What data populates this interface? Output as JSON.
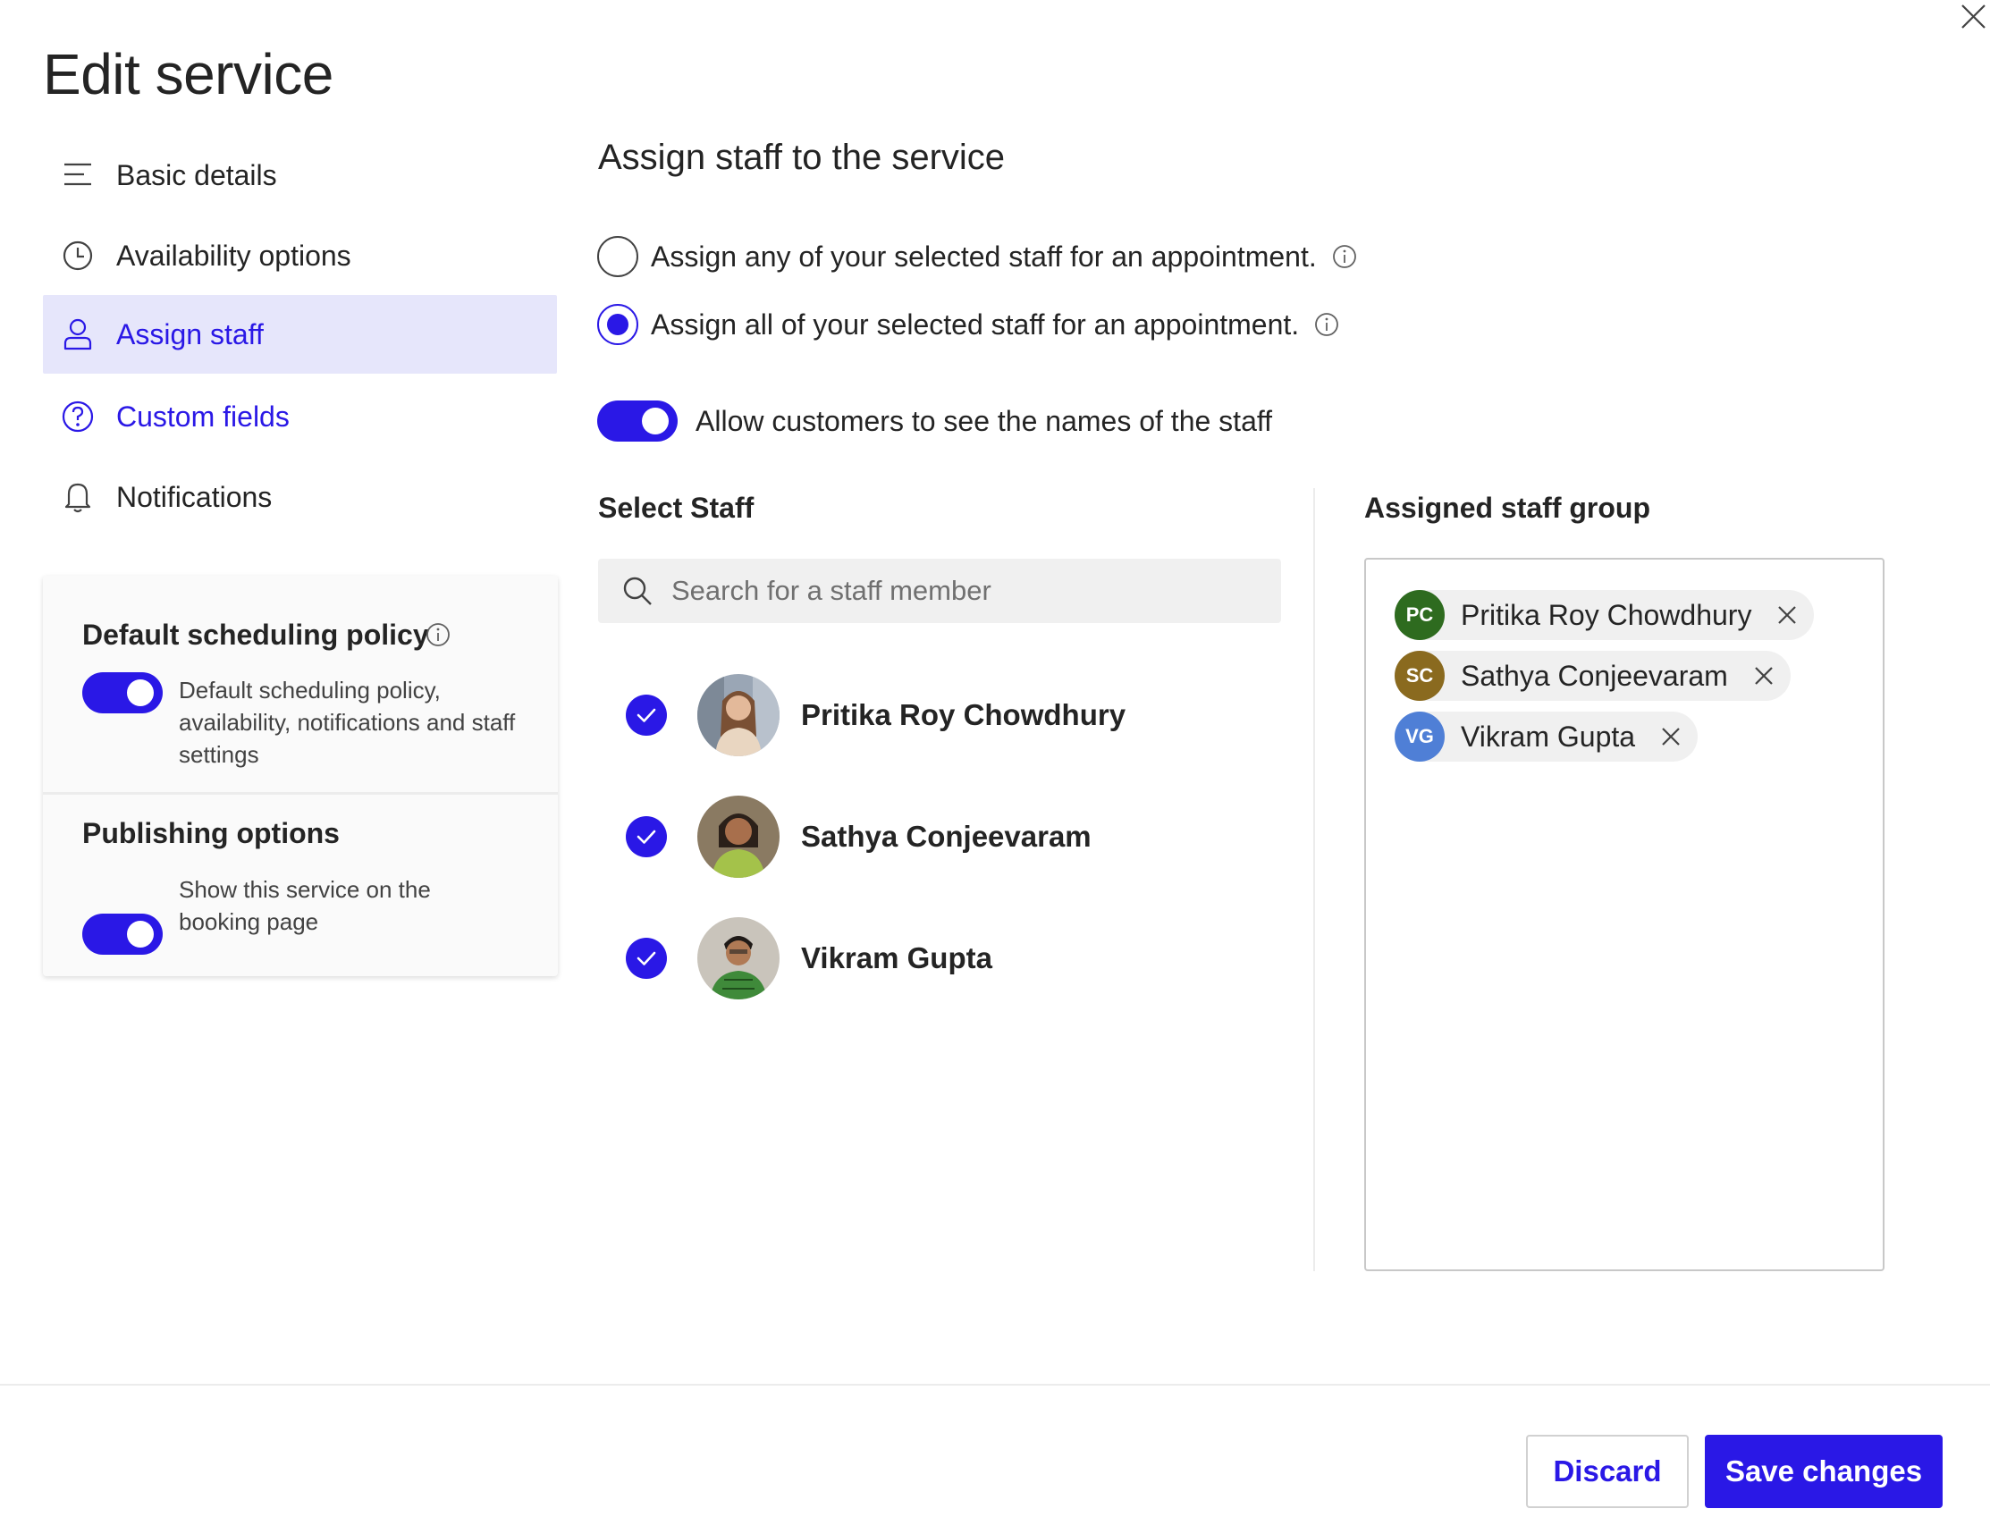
{
  "dialog": {
    "title": "Edit service",
    "close_icon": "close-icon"
  },
  "nav": {
    "items": [
      {
        "label": "Basic details",
        "icon": "text-lines-icon",
        "state": "default"
      },
      {
        "label": "Availability options",
        "icon": "clock-icon",
        "state": "default"
      },
      {
        "label": "Assign staff",
        "icon": "person-icon",
        "state": "active"
      },
      {
        "label": "Custom fields",
        "icon": "question-circle-icon",
        "state": "link"
      },
      {
        "label": "Notifications",
        "icon": "bell-icon",
        "state": "default"
      }
    ]
  },
  "policy": {
    "default_heading": "Default scheduling policy",
    "default_toggle_on": true,
    "default_desc": "Default scheduling policy, availability, notifications and staff settings",
    "publishing_heading": "Publishing options",
    "publishing_toggle_on": true,
    "publishing_desc": "Show this service on the booking page"
  },
  "main": {
    "section_title": "Assign staff to the service",
    "radio_options": [
      {
        "label": "Assign any of your selected staff for an appointment.",
        "checked": false
      },
      {
        "label": "Assign all of your selected staff for an appointment.",
        "checked": true
      }
    ],
    "allow_names_label": "Allow customers to see the names of the staff",
    "allow_names_on": true,
    "select_staff_heading": "Select Staff",
    "search_placeholder": "Search for a staff member",
    "search_value": "",
    "staff": [
      {
        "name": "Pritika Roy Chowdhury",
        "checked": true
      },
      {
        "name": "Sathya Conjeevaram",
        "checked": true
      },
      {
        "name": "Vikram Gupta",
        "checked": true
      }
    ],
    "assigned_heading": "Assigned staff group",
    "assigned": [
      {
        "initials": "PC",
        "name": "Pritika Roy Chowdhury",
        "color": "#2e6b1f"
      },
      {
        "initials": "SC",
        "name": "Sathya Conjeevaram",
        "color": "#8a6a1f"
      },
      {
        "initials": "VG",
        "name": "Vikram Gupta",
        "color": "#4f7fd6"
      }
    ]
  },
  "footer": {
    "discard_label": "Discard",
    "save_label": "Save changes"
  },
  "colors": {
    "accent": "#2a18e6",
    "active_nav_bg": "#e6e6fb"
  }
}
